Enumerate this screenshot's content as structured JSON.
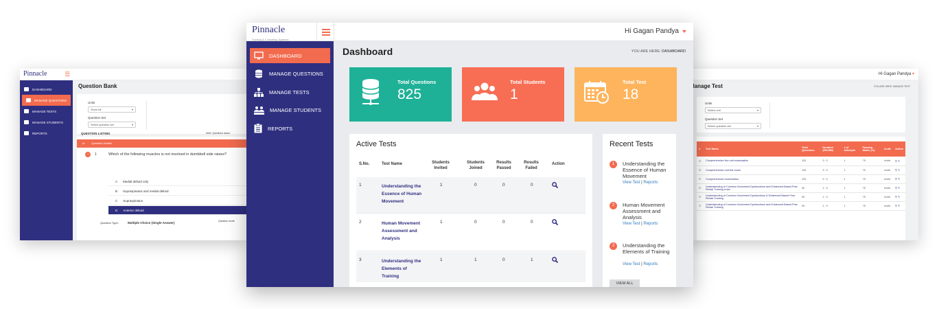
{
  "left_screen": {
    "logo": "Pinnacle",
    "sidebar": [
      "DASHBOARD",
      "MANAGE QUESTIONS",
      "MANAGE TESTS",
      "MANAGE STUDENTS",
      "REPORTS"
    ],
    "page_title": "Question Bank",
    "units_label": "Units",
    "units_value": "Show All",
    "question_set_label": "Question Set",
    "question_set_value": "Select question set",
    "listing_title": "QUESTION LISTING",
    "note": "Note: Questions assoc",
    "col_no": "Id",
    "col_details": "Question Details",
    "question_no": "1",
    "question_text": "Which of the following muscles is not involved in dumbbell side raises?",
    "options": [
      {
        "letter": "A",
        "text": "Medial deltoid only"
      },
      {
        "letter": "B",
        "text": "Supraspinatus and medial deltoid"
      },
      {
        "letter": "C",
        "text": "Supraspinatus"
      },
      {
        "letter": "D",
        "text": "Anterior deltoid"
      }
    ],
    "question_type_label": "Question Type:",
    "question_type_value": "Multiple Choice (Single Answer)",
    "question_extra": "Question mode"
  },
  "main_screen": {
    "logo": "Pinnacle",
    "logo_sub": "Training & Consulting Systems",
    "user": "Hi Gagan Pandya",
    "sidebar": [
      {
        "label": "DASHBOARD",
        "icon": "monitor-icon",
        "active": true
      },
      {
        "label": "MANAGE QUESTIONS",
        "icon": "database-icon",
        "active": false
      },
      {
        "label": "MANAGE TESTS",
        "icon": "hierarchy-icon",
        "active": false
      },
      {
        "label": "MANAGE STUDENTS",
        "icon": "students-icon",
        "active": false
      },
      {
        "label": "REPORTS",
        "icon": "clipboard-icon",
        "active": false
      }
    ],
    "page_title": "Dashboard",
    "breadcrumb_prefix": "YOU ARE HERE:",
    "breadcrumb_current": "DASHBOARD",
    "stats": [
      {
        "label": "Total Questions",
        "value": "825",
        "color": "#1fb197",
        "icon": "database-icon"
      },
      {
        "label": "Total Students",
        "value": "1",
        "color": "#f76e54",
        "icon": "users-icon"
      },
      {
        "label": "Total Test",
        "value": "18",
        "color": "#fdb45c",
        "icon": "calendar-icon"
      }
    ],
    "active_tests": {
      "title": "Active Tests",
      "headers": [
        "S.No.",
        "Test Name",
        "Students Invited",
        "Students Joined",
        "Results Passed",
        "Results Failed",
        "Action"
      ],
      "rows": [
        {
          "sno": "1",
          "name": "Understanding the Essence of Human Movement",
          "invited": "1",
          "joined": "0",
          "passed": "0",
          "failed": "0"
        },
        {
          "sno": "2",
          "name": "Human Movement Assessment and Analysis",
          "invited": "1",
          "joined": "0",
          "passed": "0",
          "failed": "0"
        },
        {
          "sno": "3",
          "name": "Understanding the Elements of Training",
          "invited": "1",
          "joined": "1",
          "passed": "0",
          "failed": "1"
        }
      ]
    },
    "recent_tests": {
      "title": "Recent Tests",
      "items": [
        {
          "num": "1",
          "name": "Understanding the Essence of Human Movement"
        },
        {
          "num": "2",
          "name": "Human Movement Assessment and Analysis"
        },
        {
          "num": "3",
          "name": "Understanding the Elements of Training"
        }
      ],
      "view_test": "View Test",
      "reports": "Reports",
      "separator": "|",
      "view_all": "VIEW ALL"
    }
  },
  "right_screen": {
    "user": "Hi Gagan Pandya",
    "page_title": "Manage Test",
    "breadcrumb": "YOU ARE HERE: MANAGE TEST",
    "units_label": "Units",
    "units_value": "Select unit",
    "question_set_label": "Question Set",
    "question_set_value": "Select question set",
    "listing_title": "TEST LISTING",
    "headers": [
      "Test Name",
      "Total Questions",
      "Duration (HH:MM)",
      "# of Attempts",
      "Passing Marks (%)",
      "Invite",
      "Action"
    ],
    "rows": [
      {
        "name": "Comprehensive five unit examination",
        "q": "125",
        "d": "3 : 0",
        "a": "1",
        "p": "75",
        "i": "Invite"
      },
      {
        "name": "Comprehensive unit five exam",
        "q": "125",
        "d": "3 : 0",
        "a": "1",
        "p": "75",
        "i": "Invite"
      },
      {
        "name": "Comprehensive examination",
        "q": "125",
        "d": "3 : 0",
        "a": "1",
        "p": "75",
        "i": "Invite"
      },
      {
        "name": "Understanding of Common Movement Dysfunctions and Evidenced Based Post Rehab Training exam",
        "q": "30",
        "d": "1 : 0",
        "a": "1",
        "p": "75",
        "i": "Invite"
      },
      {
        "name": "Understanding of Common Movement Dysfunctions & Evidenced Based Post Rehab Training",
        "q": "30",
        "d": "1 : 0",
        "a": "1",
        "p": "75",
        "i": "Invite"
      },
      {
        "name": "Understanding of Common Movement Dysfunctions and Evidenced Based Post Rehab Training",
        "q": "30",
        "d": "1 : 0",
        "a": "1",
        "p": "75",
        "i": "Invite"
      }
    ]
  }
}
